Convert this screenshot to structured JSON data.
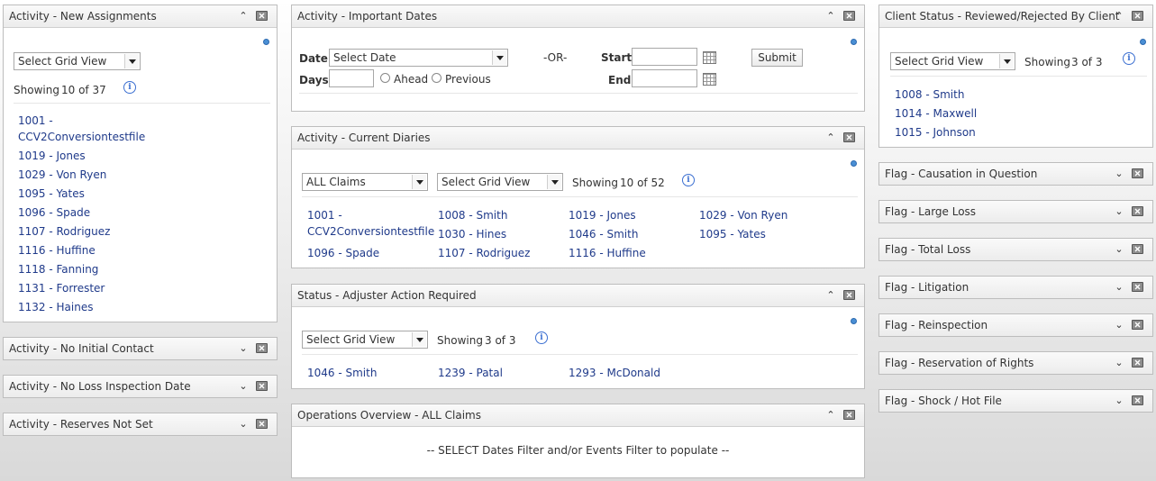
{
  "new_assignments": {
    "title": "Activity - New Assignments",
    "grid_view": "Select Grid View",
    "showing_label": "Showing",
    "showing": "10 of 37",
    "items": [
      "1001 -",
      "CCV2Conversiontestfile",
      "1019 - Jones",
      "1029 - Von Ryen",
      "1095 - Yates",
      "1096 - Spade",
      "1107 - Rodriguez",
      "1116 - Huffine",
      "1118 - Fanning",
      "1131 - Forrester",
      "1132 - Haines"
    ]
  },
  "left_collapsed": [
    "Activity - No Initial Contact",
    "Activity - No Loss Inspection Date",
    "Activity - Reserves Not Set"
  ],
  "important_dates": {
    "title": "Activity - Important Dates",
    "date_label": "Date:",
    "date_select": "Select Date",
    "or_label": "-OR-",
    "start_label": "Start:",
    "end_label": "End:",
    "days_label": "Days:",
    "ahead_label": "Ahead",
    "previous_label": "Previous",
    "submit_label": "Submit"
  },
  "current_diaries": {
    "title": "Activity - Current Diaries",
    "filter": "ALL Claims",
    "grid_view": "Select Grid View",
    "showing_label": "Showing",
    "showing": "10 of 52",
    "items": [
      "1001 -",
      "CCV2Conversiontestfile",
      "1096 - Spade",
      "1008 - Smith",
      "1030 - Hines",
      "1107 - Rodriguez",
      "1019 - Jones",
      "1046 - Smith",
      "1116 - Huffine",
      "1029 - Von Ryen",
      "1095 - Yates"
    ]
  },
  "adjuster_action": {
    "title": "Status - Adjuster Action Required",
    "grid_view": "Select Grid View",
    "showing_label": "Showing",
    "showing": "3 of 3",
    "items": [
      "1046 - Smith",
      "1239 - Patal",
      "1293 - McDonald"
    ]
  },
  "operations": {
    "title": "Operations Overview - ALL Claims",
    "message": "-- SELECT Dates Filter and/or Events Filter to populate --"
  },
  "client_status": {
    "title": "Client Status - Reviewed/Rejected By Client",
    "grid_view": "Select Grid View",
    "showing_label": "Showing",
    "showing": "3 of 3",
    "items": [
      "1008 - Smith",
      "1014 - Maxwell",
      "1015 - Johnson"
    ]
  },
  "flags": [
    "Flag - Causation in Question",
    "Flag - Large Loss",
    "Flag - Total Loss",
    "Flag - Litigation",
    "Flag - Reinspection",
    "Flag - Reservation of Rights",
    "Flag - Shock / Hot File"
  ],
  "icons": {
    "collapse": "chevron-up-icon",
    "expand": "chevron-down-icon",
    "close": "close-icon",
    "info": "info-icon",
    "settings": "settings-dot-icon",
    "calendar": "calendar-icon"
  }
}
